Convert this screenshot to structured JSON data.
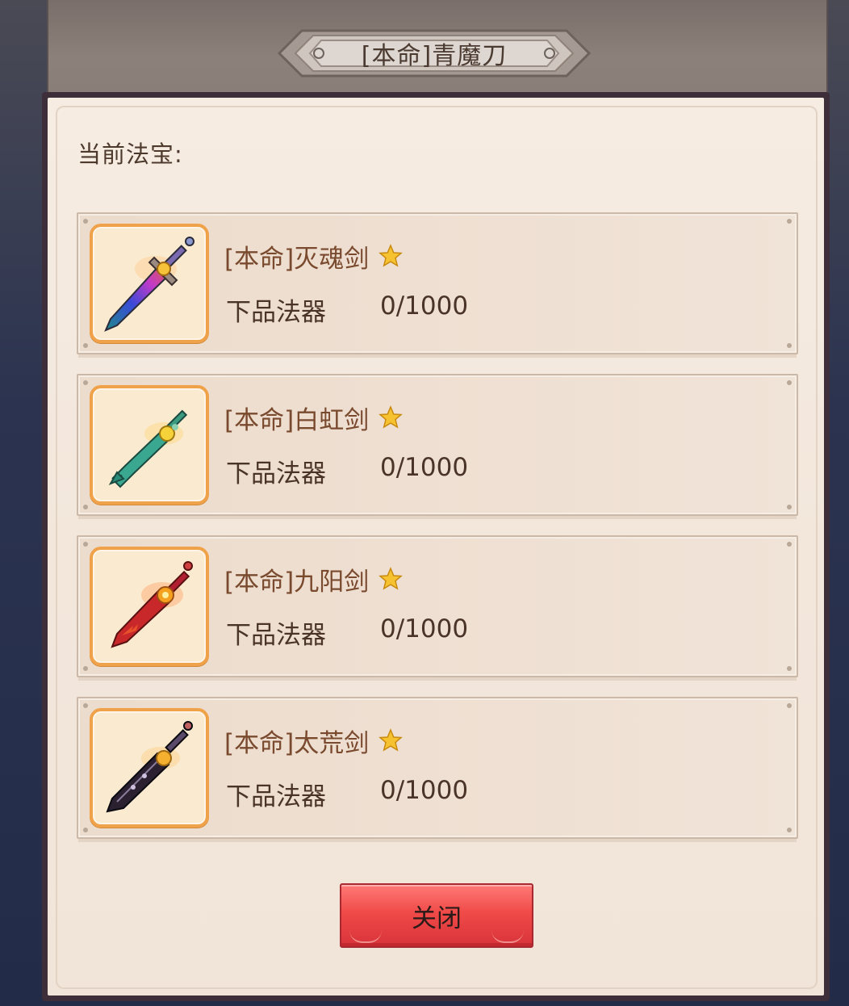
{
  "dialog": {
    "title": "[本命]青魔刀",
    "section_label": "当前法宝:",
    "close_label": "关闭"
  },
  "items": [
    {
      "name": "[本命]灭魂剑",
      "grade": "下品法器",
      "progress": "0/1000",
      "icon": "sword-rainbow-icon",
      "star_count": 1
    },
    {
      "name": "[本命]白虹剑",
      "grade": "下品法器",
      "progress": "0/1000",
      "icon": "sword-jade-icon",
      "star_count": 1
    },
    {
      "name": "[本命]九阳剑",
      "grade": "下品法器",
      "progress": "0/1000",
      "icon": "sword-fire-icon",
      "star_count": 1
    },
    {
      "name": "[本命]太荒剑",
      "grade": "下品法器",
      "progress": "0/1000",
      "icon": "sword-dark-icon",
      "star_count": 1
    }
  ],
  "colors": {
    "accent_orange": "#f0a24a",
    "close_red": "#f04a48",
    "panel_bg": "#f3e7dc",
    "name_text": "#7a4a2e"
  }
}
